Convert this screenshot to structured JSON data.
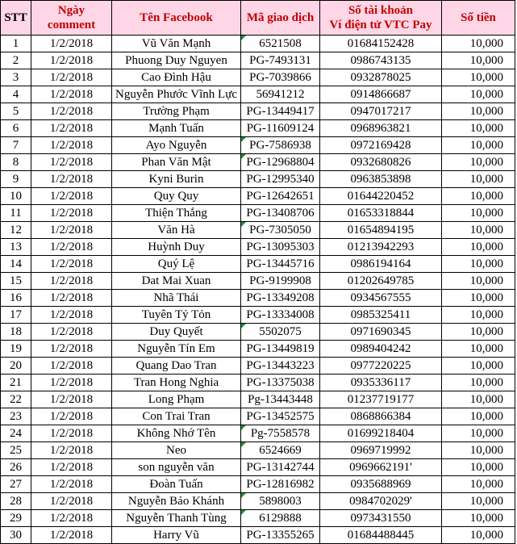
{
  "headers": {
    "stt": "STT",
    "date_line1": "Ngày",
    "date_line2": "comment",
    "facebook": "Tên Facebook",
    "txn": "Mã giao dịch",
    "account_line1": "Số tài khoản",
    "account_line2": "Ví điện tử VTC Pay",
    "amount": "Số tiền"
  },
  "rows": [
    {
      "stt": "1",
      "date": "1/2/2018",
      "name": "Vũ Văn Mạnh",
      "txn": "6521508",
      "account": "01684152428",
      "amount": "10,000"
    },
    {
      "stt": "2",
      "date": "1/2/2018",
      "name": "Phuong Duy Nguyen",
      "txn": "PG-7493131",
      "account": "0986743135",
      "amount": "10,000"
    },
    {
      "stt": "3",
      "date": "1/2/2018",
      "name": "Cao Đình Hậu",
      "txn": "PG-7039866",
      "account": "0932878025",
      "amount": "10,000"
    },
    {
      "stt": "4",
      "date": "1/2/2018",
      "name": "Nguyễn Phước Vĩnh Lực",
      "txn": "56941212",
      "account": "0914866687",
      "amount": "10,000"
    },
    {
      "stt": "5",
      "date": "1/2/2018",
      "name": "Trường Phạm",
      "txn": "PG-13449417",
      "account": "0947017217",
      "amount": "10,000"
    },
    {
      "stt": "6",
      "date": "1/2/2018",
      "name": "Mạnh Tuấn",
      "txn": "PG-11609124",
      "account": "0968963821",
      "amount": "10,000"
    },
    {
      "stt": "7",
      "date": "1/2/2018",
      "name": "Ayo Nguyễn",
      "txn": "PG-7586938",
      "account": "0972169428",
      "amount": "10,000"
    },
    {
      "stt": "8",
      "date": "1/2/2018",
      "name": "Phan Văn Mật",
      "txn": "PG-12968804",
      "account": "0932680826",
      "amount": "10,000"
    },
    {
      "stt": "9",
      "date": "1/2/2018",
      "name": "Kyni Burin",
      "txn": "PG-12995340",
      "account": "0963853898",
      "amount": "10,000"
    },
    {
      "stt": "10",
      "date": "1/2/2018",
      "name": "Quy Quy",
      "txn": "PG-12642651",
      "account": "01644220452",
      "amount": "10,000"
    },
    {
      "stt": "11",
      "date": "1/2/2018",
      "name": "Thiện Thắng",
      "txn": "PG-13408706",
      "account": "01653318844",
      "amount": "10,000"
    },
    {
      "stt": "12",
      "date": "1/2/2018",
      "name": "Văn Hà",
      "txn": "PG-7305050",
      "account": "01654894195",
      "amount": "10,000"
    },
    {
      "stt": "13",
      "date": "1/2/2018",
      "name": "Huỳnh Duy",
      "txn": "PG-13095303",
      "account": "01213942293",
      "amount": "10,000"
    },
    {
      "stt": "14",
      "date": "1/2/2018",
      "name": "Quý Lệ",
      "txn": "PG-13445716",
      "account": "0986194164",
      "amount": "10,000"
    },
    {
      "stt": "15",
      "date": "1/2/2018",
      "name": "Dat Mai Xuan",
      "txn": "PG-9199908",
      "account": "01202649785",
      "amount": "10,000"
    },
    {
      "stt": "16",
      "date": "1/2/2018",
      "name": "Nhã Thái",
      "txn": "PG-13349208",
      "account": "0934567555",
      "amount": "10,000"
    },
    {
      "stt": "17",
      "date": "1/2/2018",
      "name": "Tuyên Tỷ Tỏn",
      "txn": "PG-13334008",
      "account": "0985325411",
      "amount": "10,000"
    },
    {
      "stt": "18",
      "date": "1/2/2018",
      "name": "Duy Quyết",
      "txn": "5502075",
      "account": "0971690345",
      "amount": "10,000"
    },
    {
      "stt": "19",
      "date": "1/2/2018",
      "name": "Nguyễn Tín Em",
      "txn": "PG-13449819",
      "account": "0989404242",
      "amount": "10,000"
    },
    {
      "stt": "20",
      "date": "1/2/2018",
      "name": "Quang Dao Tran",
      "txn": "PG-13443223",
      "account": "0977220225",
      "amount": "10,000"
    },
    {
      "stt": "21",
      "date": "1/2/2018",
      "name": "Tran Hong Nghia",
      "txn": "PG-13375038",
      "account": "0935336117",
      "amount": "10,000"
    },
    {
      "stt": "22",
      "date": "1/2/2018",
      "name": "Long Phạm",
      "txn": "Pg-13443448",
      "account": "01237719177",
      "amount": "10,000"
    },
    {
      "stt": "23",
      "date": "1/2/2018",
      "name": "Con Trai Tran",
      "txn": "PG-13452575",
      "account": "0868866384",
      "amount": "10,000"
    },
    {
      "stt": "24",
      "date": "1/2/2018",
      "name": "Không Nhớ Tên",
      "txn": "Pg-7558578",
      "account": "01699218404",
      "amount": "10,000"
    },
    {
      "stt": "25",
      "date": "1/2/2018",
      "name": "Neo",
      "txn": "6524669",
      "account": "0969719992",
      "amount": "10,000"
    },
    {
      "stt": "26",
      "date": "1/2/2018",
      "name": "son nguyễn văn",
      "txn": "PG-13142744",
      "account": "0969662191'",
      "amount": "10,000"
    },
    {
      "stt": "27",
      "date": "1/2/2018",
      "name": "Đoàn Tuấn",
      "txn": "PG-12816982",
      "account": "0935688969",
      "amount": "10,000"
    },
    {
      "stt": "28",
      "date": "1/2/2018",
      "name": "Nguyễn Bảo Khánh",
      "txn": "5898003",
      "account": "0984702029'",
      "amount": "10,000"
    },
    {
      "stt": "29",
      "date": "1/2/2018",
      "name": "Nguyễn Thanh Tùng",
      "txn": "6129888",
      "account": "0973431550",
      "amount": "10,000"
    },
    {
      "stt": "30",
      "date": "1/2/2018",
      "name": "Harry Vũ",
      "txn": "PG-13355265",
      "account": "01684488445",
      "amount": "10,000"
    }
  ],
  "green_flag_txn_rows": [
    0,
    6,
    7,
    11,
    17,
    23,
    24,
    27,
    28
  ],
  "colors": {
    "header_bg": "#ffd6e6",
    "header_text": "#c00000",
    "cell_flag": "#1f8f3a"
  }
}
